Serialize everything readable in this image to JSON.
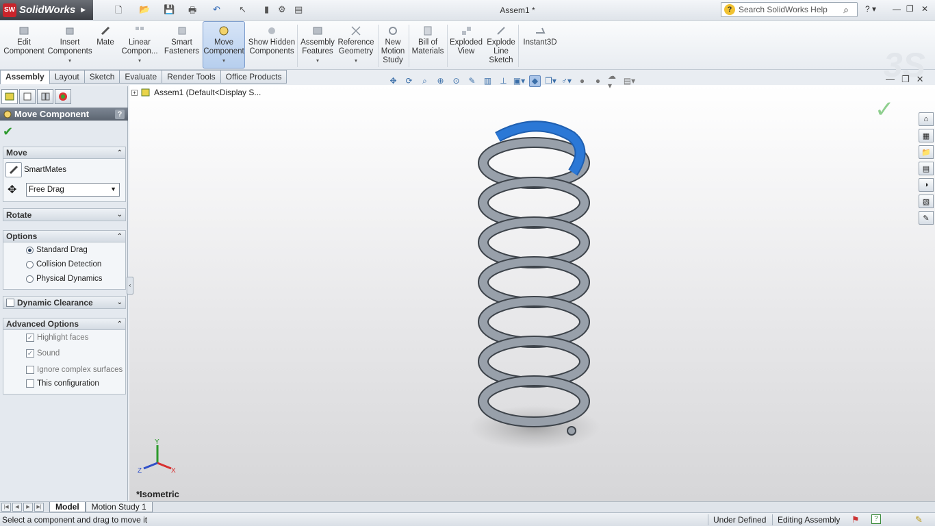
{
  "app": {
    "name": "SolidWorks",
    "doc_title": "Assem1 *"
  },
  "search": {
    "placeholder": "Search SolidWorks Help"
  },
  "commands": [
    {
      "label": "Edit Component"
    },
    {
      "label": "Insert Components"
    },
    {
      "label": "Mate"
    },
    {
      "label": "Linear Compon..."
    },
    {
      "label": "Smart Fasteners"
    },
    {
      "label": "Move Component"
    },
    {
      "label": "Show Hidden Components"
    },
    {
      "label": "Assembly Features"
    },
    {
      "label": "Reference Geometry"
    },
    {
      "label": "New Motion Study"
    },
    {
      "label": "Bill of Materials"
    },
    {
      "label": "Exploded View"
    },
    {
      "label": "Explode Line Sketch"
    },
    {
      "label": "Instant3D"
    }
  ],
  "tabs": [
    "Assembly",
    "Layout",
    "Sketch",
    "Evaluate",
    "Render Tools",
    "Office Products"
  ],
  "property_manager": {
    "title": "Move Component",
    "help": "?",
    "move": {
      "title": "Move",
      "smartmates": "SmartMates",
      "mode": "Free Drag"
    },
    "rotate": {
      "title": "Rotate"
    },
    "options": {
      "title": "Options",
      "standard": "Standard Drag",
      "collision": "Collision Detection",
      "physical": "Physical Dynamics"
    },
    "dynamic": {
      "title": "Dynamic Clearance"
    },
    "advanced": {
      "title": "Advanced Options",
      "highlight": "Highlight faces",
      "sound": "Sound",
      "ignore": "Ignore complex surfaces",
      "config": "This configuration"
    }
  },
  "tree": {
    "label": "Assem1  (Default<Display S..."
  },
  "view": {
    "orientation": "*Isometric",
    "triad_x": "X",
    "triad_y": "Y",
    "triad_z": "Z"
  },
  "bottom_tabs": [
    "Model",
    "Motion Study 1"
  ],
  "status": {
    "message": "Select a component and drag to move it",
    "defined": "Under Defined",
    "mode": "Editing Assembly"
  },
  "colors": {
    "accent": "#2b78d6",
    "spring": "#8a919c"
  }
}
